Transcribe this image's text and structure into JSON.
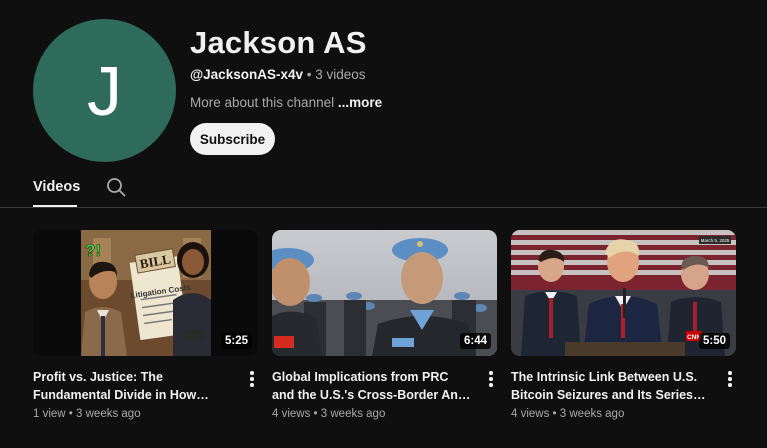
{
  "channel": {
    "avatar_letter": "J",
    "avatar_color": "#2f6b5a",
    "name": "Jackson AS",
    "handle": "@JacksonAS-x4v",
    "separator": " • ",
    "video_count": "3 videos",
    "about": "More about this channel ",
    "more_label": "...more",
    "subscribe_label": "Subscribe"
  },
  "tabs": {
    "videos_label": "Videos",
    "search_icon": "search-icon"
  },
  "videos": [
    {
      "title": "Profit vs. Justice: The Fundamental Divide in How China and the U.S....",
      "duration": "5:25",
      "views": "1 view",
      "age": "3 weeks ago",
      "thumb_text": {
        "bill": "BILL",
        "doc": "Litigation Costs",
        "marks": "?!"
      }
    },
    {
      "title": "Global Implications from PRC and the U.S.'s Cross-Border Anti-Fraud...",
      "duration": "6:44",
      "views": "4 views",
      "age": "3 weeks ago"
    },
    {
      "title": "The Intrinsic Link Between U.S. Bitcoin Seizures and Its Series of...",
      "duration": "5:50",
      "views": "4 views",
      "age": "3 weeks ago",
      "thumb_text": {
        "date": "March 5, 2025",
        "logo": "CNN"
      }
    }
  ],
  "meta_separator": " • ",
  "colors": {
    "background": "#0f0f0f",
    "text": "#f1f1f1",
    "muted": "#aaaaaa"
  }
}
